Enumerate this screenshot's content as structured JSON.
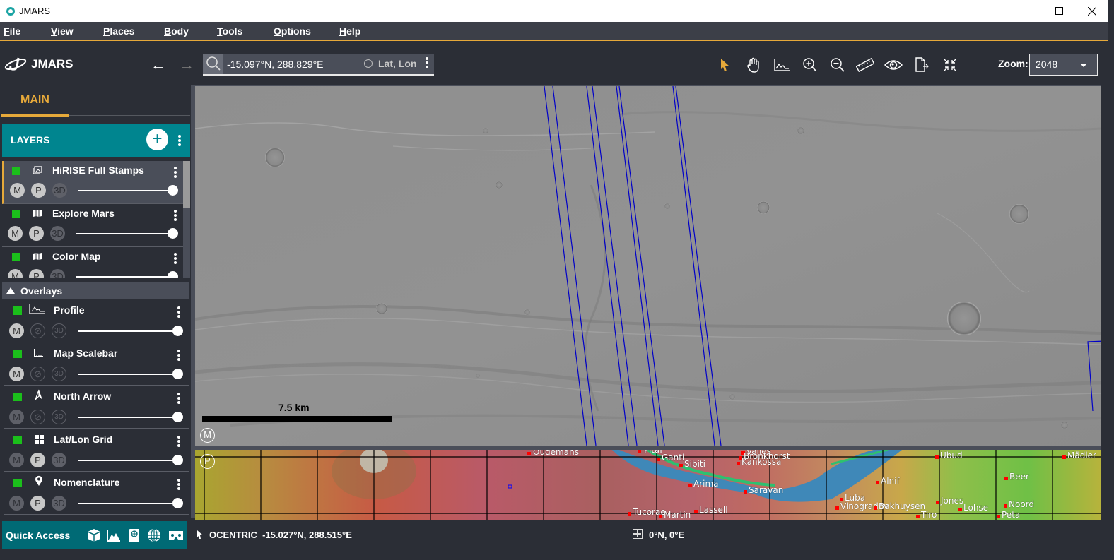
{
  "window": {
    "title": "JMARS",
    "controls": {
      "minimize": "—",
      "maximize": "☐",
      "close": "✕"
    }
  },
  "menu": [
    {
      "label": "File",
      "mnemonic": "F",
      "rest": "ile"
    },
    {
      "label": "View",
      "mnemonic": "V",
      "rest": "iew"
    },
    {
      "label": "Places",
      "mnemonic": "P",
      "rest": "laces"
    },
    {
      "label": "Body",
      "mnemonic": "B",
      "rest": "ody"
    },
    {
      "label": "Tools",
      "mnemonic": "T",
      "rest": "ools"
    },
    {
      "label": "Options",
      "mnemonic": "O",
      "rest": "ptions"
    },
    {
      "label": "Help",
      "mnemonic": "H",
      "rest": "elp"
    }
  ],
  "toolbar": {
    "logo_text": "JMARS",
    "back_icon": "←",
    "forward_icon": "→",
    "search_value": "-15.097°N, 288.829°E",
    "search_mode": "Lat, Lon",
    "tools": [
      "select-pointer",
      "pan-hand",
      "profile-chart",
      "zoom-in",
      "zoom-out",
      "measure-ruler",
      "investigate-eye",
      "export-document",
      "resize-collapse"
    ],
    "zoom_label": "Zoom:",
    "zoom_value": "2048",
    "accent_color": "#e6a93a"
  },
  "sidebar": {
    "tab_main": "MAIN",
    "layers_header": "LAYERS",
    "add_icon": "+",
    "layers": [
      {
        "name": "HiRISE Full Stamps",
        "icon": "stamps",
        "visible": true,
        "selected": true,
        "m": "on",
        "p": "on",
        "d3": "dim",
        "opacity": 1.0
      },
      {
        "name": "Explore Mars",
        "icon": "map",
        "visible": true,
        "selected": false,
        "m": "on",
        "p": "on",
        "d3": "dim",
        "opacity": 1.0
      },
      {
        "name": "Color Map",
        "icon": "map",
        "visible": true,
        "selected": false,
        "m": "on",
        "p": "on",
        "d3": "dim",
        "opacity": 1.0
      }
    ],
    "overlays_header": "Overlays",
    "overlays": [
      {
        "name": "Profile",
        "icon": "profile",
        "visible": true,
        "m": "on",
        "p": "off",
        "d3": "off",
        "opacity": 1.0
      },
      {
        "name": "Map Scalebar",
        "icon": "scalebar",
        "visible": true,
        "m": "on",
        "p": "off",
        "d3": "off",
        "opacity": 1.0
      },
      {
        "name": "North Arrow",
        "icon": "north-arrow",
        "visible": true,
        "m": "dim",
        "p": "off",
        "d3": "off",
        "opacity": 1.0
      },
      {
        "name": "Lat/Lon Grid",
        "icon": "grid",
        "visible": true,
        "m": "dim",
        "p": "on",
        "d3": "dim",
        "opacity": 1.0
      },
      {
        "name": "Nomenclature",
        "icon": "pin",
        "visible": true,
        "m": "dim",
        "p": "on",
        "d3": "dim",
        "opacity": 1.0
      }
    ],
    "pill_labels": {
      "m": "M",
      "p": "P",
      "d3": "3D"
    },
    "quick_access_label": "Quick Access",
    "quick_access_icons": [
      "3d-cube",
      "elevation-chart",
      "atlas-book",
      "globe",
      "vr-headset"
    ]
  },
  "map": {
    "main_badge": "M",
    "panner_badge": "P",
    "scale_label": "7.5 km",
    "stamp_color": "#0000c8",
    "place_names": [
      {
        "name": "Oudemans"
      },
      {
        "name": "Pital"
      },
      {
        "name": "Valles"
      },
      {
        "name": "Bronkhorst"
      },
      {
        "name": "Kankossa"
      },
      {
        "name": "Ganti"
      },
      {
        "name": "Sibiti"
      },
      {
        "name": "Arima"
      },
      {
        "name": "Saravan"
      },
      {
        "name": "Tucorae"
      },
      {
        "name": "Martin"
      },
      {
        "name": "Lassell"
      },
      {
        "name": "Ubud"
      },
      {
        "name": "Mädler"
      },
      {
        "name": "Alnif"
      },
      {
        "name": "Beer"
      },
      {
        "name": "Luba"
      },
      {
        "name": "Vinogradov"
      },
      {
        "name": "Bakhuysen"
      },
      {
        "name": "Jones"
      },
      {
        "name": "Noord"
      },
      {
        "name": "Lohse"
      },
      {
        "name": "Peta"
      },
      {
        "name": "Tiro"
      }
    ]
  },
  "status": {
    "coord_system": "OCENTRIC",
    "cursor_coord": "-15.027°N, 288.515°E",
    "grid_coord": "0°N, 0°E"
  }
}
